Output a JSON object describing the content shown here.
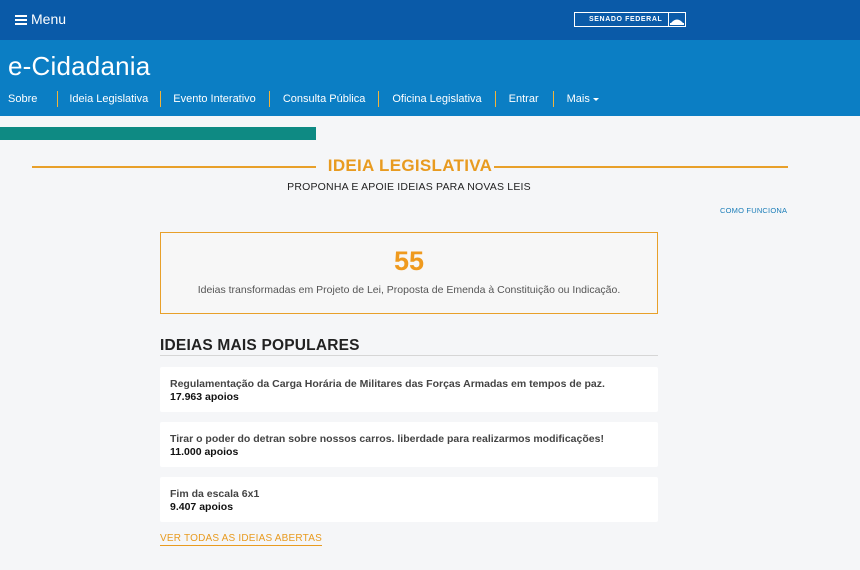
{
  "topbar": {
    "menu_label": "Menu",
    "senado_label": "SENADO FEDERAL"
  },
  "header": {
    "title": "e-Cidadania",
    "nav": [
      {
        "label": "Sobre"
      },
      {
        "label": "Ideia Legislativa"
      },
      {
        "label": "Evento Interativo"
      },
      {
        "label": "Consulta Pública"
      },
      {
        "label": "Oficina Legislativa"
      },
      {
        "label": "Entrar"
      },
      {
        "label": "Mais"
      }
    ]
  },
  "section": {
    "title": "IDEIA LEGISLATIVA",
    "subtitle": "PROPONHA E APOIE IDEIAS PARA NOVAS LEIS",
    "how_it_works": "COMO FUNCIONA"
  },
  "stat": {
    "number": "55",
    "description": "Ideias transformadas em Projeto de Lei, Proposta de Emenda à Constituição ou Indicação."
  },
  "popular": {
    "title": "IDEIAS MAIS POPULARES",
    "ideas": [
      {
        "title": "Regulamentação da Carga Horária de Militares das Forças Armadas em tempos de paz.",
        "supports": "17.963 apoios"
      },
      {
        "title": "Tirar o poder do detran sobre nossos carros. liberdade para realizarmos modificações!",
        "supports": "11.000 apoios"
      },
      {
        "title": "Fim da escala 6x1",
        "supports": "9.407 apoios"
      }
    ],
    "see_all": "VER TODAS AS IDEIAS ABERTAS"
  },
  "colors": {
    "topbar": "#0a5aa8",
    "header": "#0b7ec4",
    "accent_orange": "#e89b20",
    "teal": "#0e8a83"
  }
}
